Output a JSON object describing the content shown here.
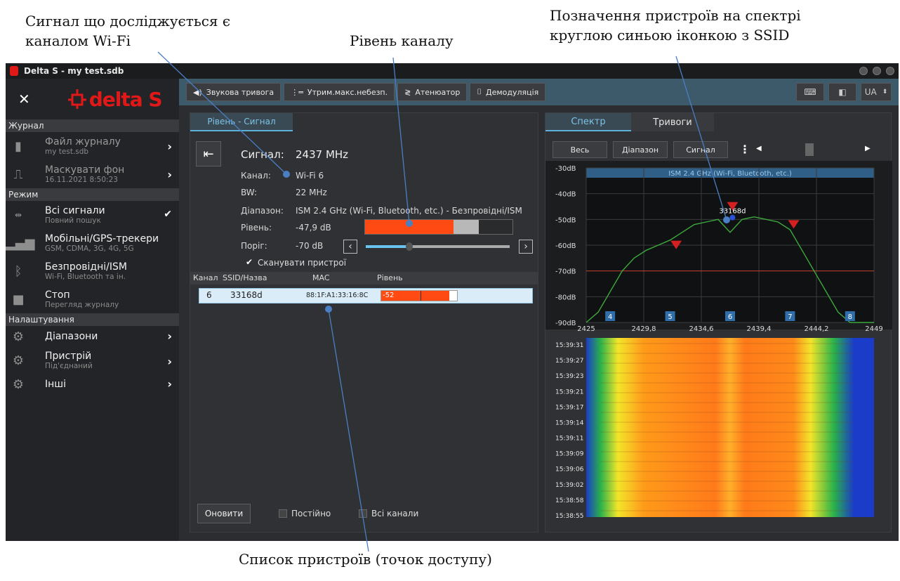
{
  "annotations": {
    "wifi": "Сигнал що досліджується є\nканалом Wi-Fi",
    "level": "Рівень каналу",
    "devices_on_spectrum": "Позначення пристроїв на спектрі\nкруглою синьою іконкою з SSID",
    "device_list": "Список пристроїв (точок доступу)"
  },
  "window": {
    "title": "Delta S - my test.sdb"
  },
  "sidebar": {
    "brand": "delta S",
    "sections": [
      {
        "title": "Журнал"
      },
      {
        "title": "Режим"
      },
      {
        "title": "Налаштування"
      }
    ],
    "journal": [
      {
        "label": "Файл журналу",
        "sub": "my test.sdb"
      },
      {
        "label": "Маскувати фон",
        "sub": "16.11.2021 8:50:23"
      }
    ],
    "mode": [
      {
        "label": "Всі сигнали",
        "sub": "Повний пошук"
      },
      {
        "label": "Мобільні/GPS-трекери",
        "sub": "GSM, CDMA, 3G, 4G, 5G"
      },
      {
        "label": "Безпровідні/ISM",
        "sub": "Wi-Fi, Bluetooth та ін."
      },
      {
        "label": "Стоп",
        "sub": "Перегляд журналу"
      }
    ],
    "settings": [
      {
        "label": "Діапазони",
        "sub": ""
      },
      {
        "label": "Пристрій",
        "sub": "Під'єднаний"
      },
      {
        "label": "Інші",
        "sub": ""
      }
    ]
  },
  "toolbar": {
    "sound_alarm": "Звукова тривога",
    "hold_max": "Утрим.макс.небезп.",
    "attenuator": "Атенюатор",
    "demod": "Демодуляція",
    "lang": "UA"
  },
  "signal": {
    "tab": "Рівень - Сигнал",
    "signal_label": "Сигнал:",
    "signal_value": "2437 MHz",
    "channel_label": "Канал:",
    "channel_value": "Wi-Fi 6",
    "bw_label": "BW:",
    "bw_value": "22 MHz",
    "range_label": "Діапазон:",
    "range_value": "ISM 2.4 GHz (Wi-Fi, Bluetooth, etc.) - Безпровідні/ISM",
    "level_label": "Рівень:",
    "level_value": "-47,9 dB",
    "level_fraction": 0.6,
    "level_peak_fraction": 0.77,
    "threshold_label": "Поріг:",
    "threshold_value": "-70 dB",
    "threshold_fraction": 0.3,
    "scan_devices": "Сканувати пристрої"
  },
  "devices": {
    "headers": [
      "Канал",
      "SSID/Назва",
      "MAC",
      "Рівень"
    ],
    "rows": [
      {
        "channel": "6",
        "ssid": "33168d",
        "mac": "88:1F:A1:33:16:8C",
        "level": "-52"
      }
    ]
  },
  "bottom": {
    "refresh": "Оновити",
    "constant": "Постійно",
    "all_channels": "Всі канали"
  },
  "spectrum": {
    "tab_spectrum": "Спектр",
    "tab_alarms": "Тривоги",
    "btn_all": "Весь",
    "btn_range": "Діапазон",
    "btn_signal": "Сигнал",
    "band_label": "ISM 2.4 GHz (Wi-Fi, Bluetooth, etc.)",
    "ssid_marker": "33168d"
  },
  "chart_data": {
    "type": "line",
    "x_ticks": [
      "2425",
      "2429,8",
      "2434,6",
      "2439,4",
      "2444,2",
      "2449"
    ],
    "y_ticks": [
      "-30dB",
      "-40dB",
      "-50dB",
      "-60dB",
      "-70dB",
      "-80dB",
      "-90dB"
    ],
    "xlim": [
      2425,
      2449
    ],
    "ylim": [
      -90,
      -30
    ],
    "threshold": -70,
    "channels": [
      {
        "label": "4",
        "x": 2427
      },
      {
        "label": "5",
        "x": 2432
      },
      {
        "label": "6",
        "x": 2437
      },
      {
        "label": "7",
        "x": 2442
      },
      {
        "label": "8",
        "x": 2447
      }
    ],
    "series": [
      {
        "x": [
          2425,
          2426,
          2427,
          2428,
          2429,
          2430,
          2431,
          2432,
          2433,
          2434,
          2435,
          2436,
          2437,
          2438,
          2439,
          2440,
          2441,
          2442,
          2443,
          2444,
          2445,
          2446,
          2447,
          2448,
          2449
        ],
        "values": [
          -90,
          -86,
          -78,
          -70,
          -65,
          -62,
          -60,
          -58,
          -55,
          -52,
          -51,
          -50,
          -55,
          -50,
          -49,
          -50,
          -51,
          -54,
          -62,
          -70,
          -78,
          -86,
          -90,
          -90,
          -90
        ]
      }
    ],
    "markers": [
      {
        "x": 2432.5,
        "y": -61
      },
      {
        "x": 2437.2,
        "y": -46
      },
      {
        "x": 2442.3,
        "y": -53
      }
    ],
    "waterfall_times": [
      "15:39:31",
      "15:39:27",
      "15:39:23",
      "15:39:21",
      "15:39:17",
      "15:39:14",
      "15:39:11",
      "15:39:09",
      "15:39:06",
      "15:39:02",
      "15:38:58",
      "15:38:55"
    ]
  }
}
